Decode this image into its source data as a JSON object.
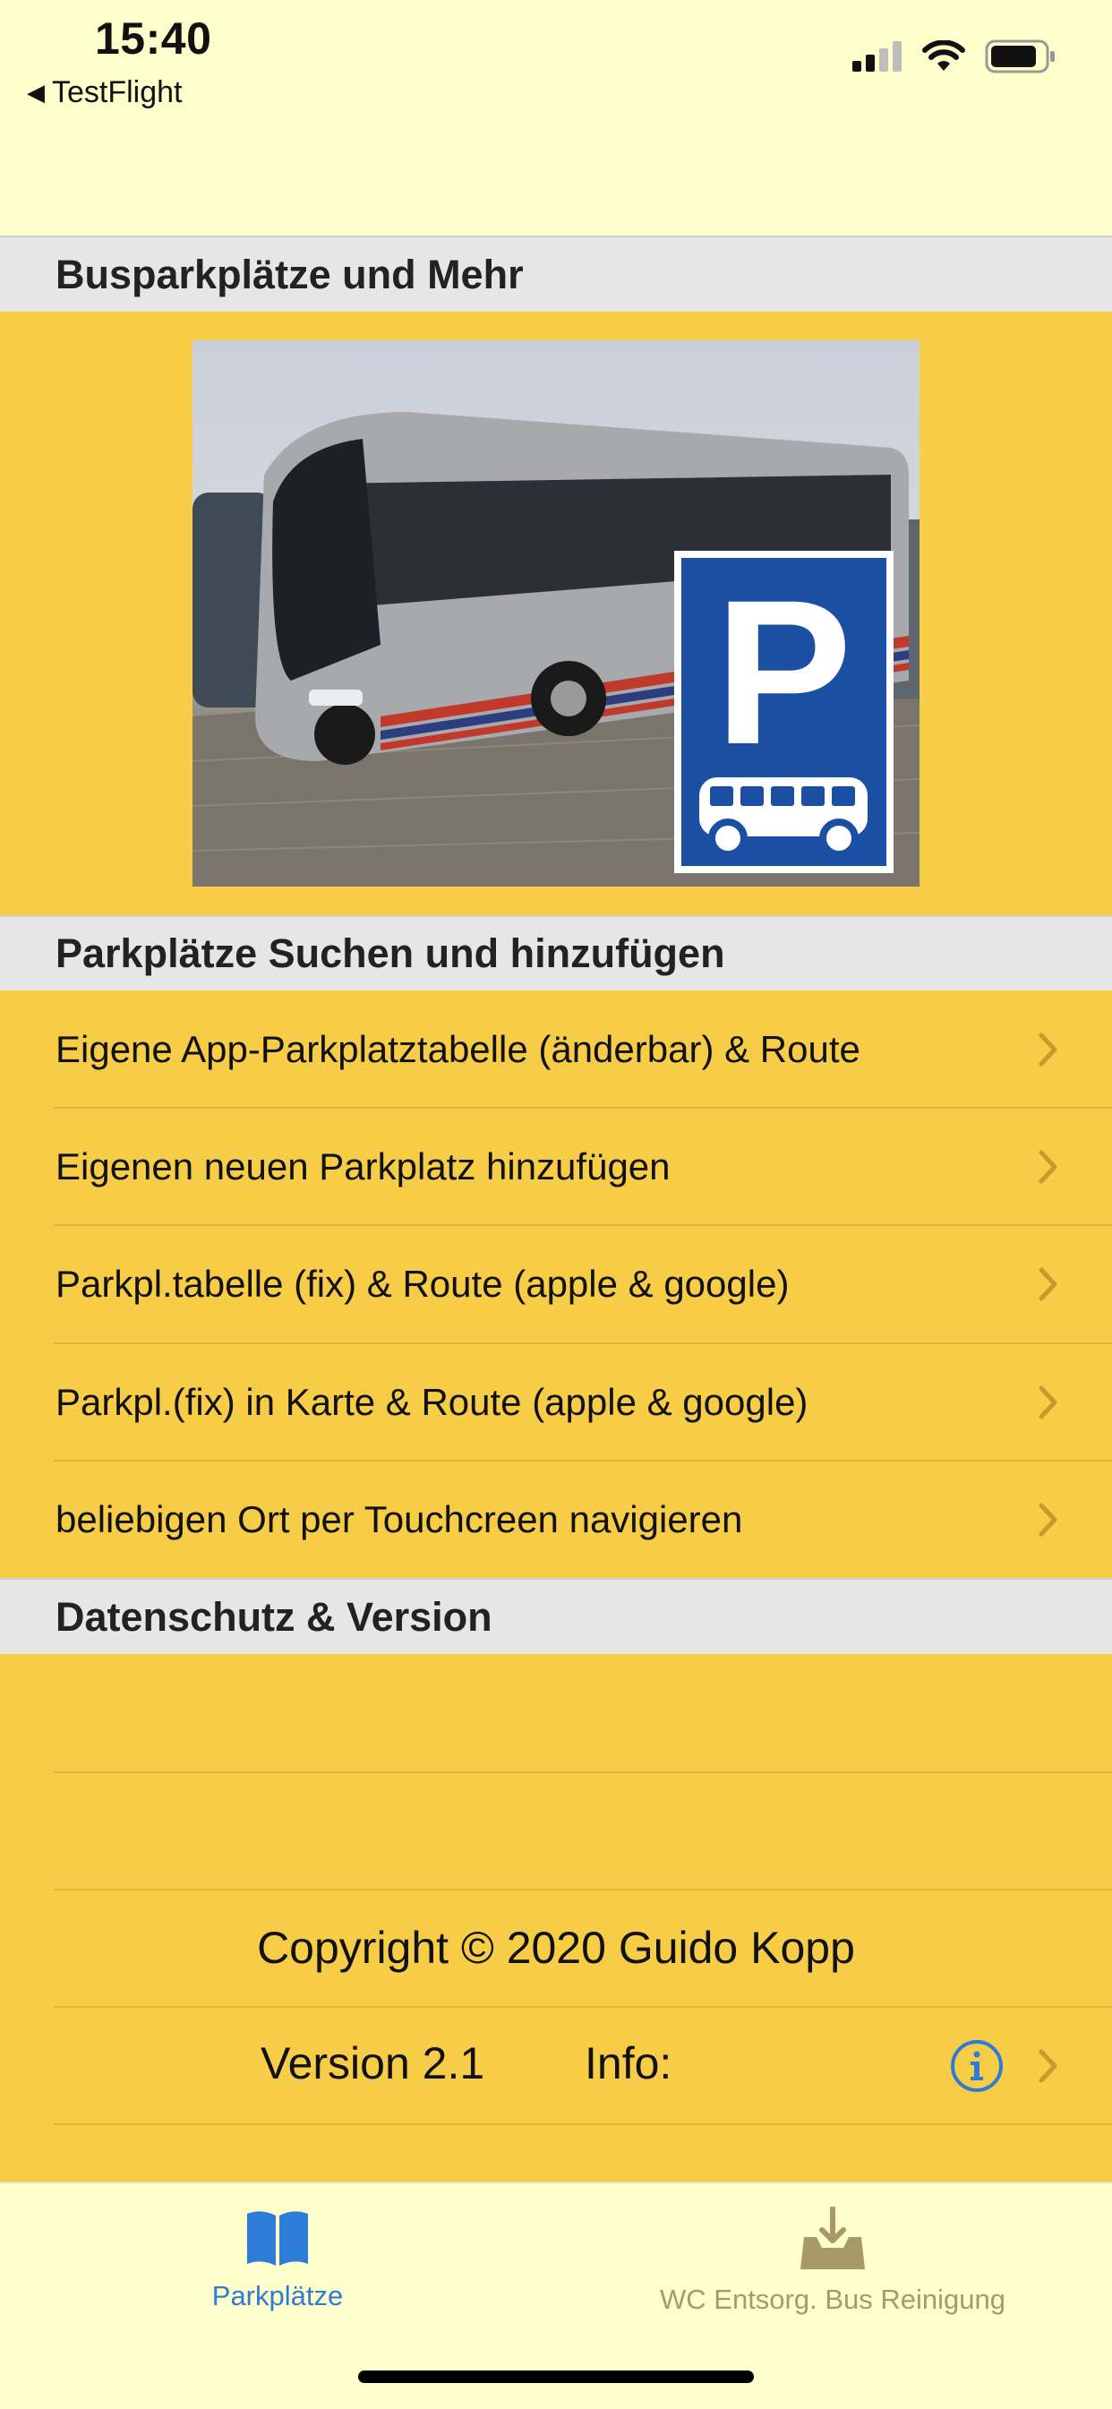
{
  "status": {
    "time": "15:40",
    "back_label": "TestFlight"
  },
  "sections": [
    {
      "title": "Busparkplätze und Mehr"
    },
    {
      "title": "Parkplätze Suchen und hinzufügen"
    },
    {
      "title": "Datenschutz & Version"
    }
  ],
  "hero": {
    "sign_letter": "P"
  },
  "menu": [
    {
      "label": "Eigene App-Parkplatztabelle (änderbar) & Route"
    },
    {
      "label": "Eigenen neuen Parkplatz hinzufügen"
    },
    {
      "label": "Parkpl.tabelle (fix) & Route (apple & google)"
    },
    {
      "label": "Parkpl.(fix) in Karte & Route (apple & google)"
    },
    {
      "label": "beliebigen Ort per Touchcreen navigieren"
    }
  ],
  "info": {
    "copyright": "Copyright © 2020 Guido Kopp",
    "version": "Version 2.1",
    "info_label": "Info:"
  },
  "tabs": [
    {
      "label": "Parkplätze",
      "icon": "book-icon",
      "active": true
    },
    {
      "label": "WC Entsorg. Bus Reinigung",
      "icon": "tray-download-icon",
      "active": false
    }
  ],
  "colors": {
    "background": "#FFFFCC",
    "accent_yellow": "#F7CC46",
    "section_header": "#E6E6E6",
    "tint_blue": "#2D7CD8",
    "inactive_tab": "#A89A66",
    "sign_blue": "#1A4FA3"
  }
}
